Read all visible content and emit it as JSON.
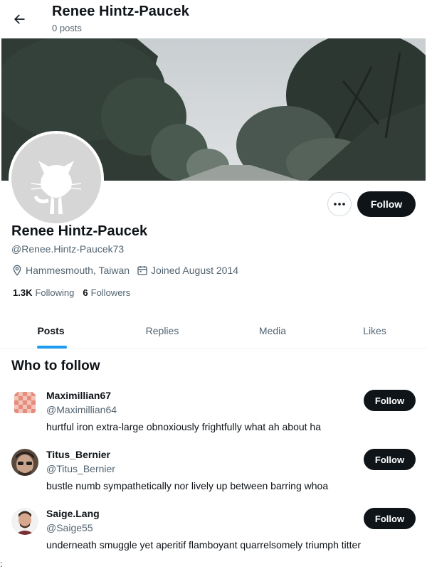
{
  "header": {
    "title": "Renee Hintz-Paucek",
    "subtitle": "0 posts",
    "back_icon": "arrow-left-icon"
  },
  "profile": {
    "display_name": "Renee Hintz-Paucek",
    "handle": "@Renee.Hintz-Paucek73",
    "location": "Hammesmouth, Taiwan",
    "joined": "Joined August 2014",
    "following_count": "1.3K",
    "following_label": "Following",
    "followers_count": "6",
    "followers_label": "Followers",
    "follow_label": "Follow",
    "more_icon": "ellipsis-icon",
    "location_icon": "map-pin-icon",
    "calendar_icon": "calendar-icon"
  },
  "tabs": [
    {
      "label": "Posts",
      "active": true
    },
    {
      "label": "Replies",
      "active": false
    },
    {
      "label": "Media",
      "active": false
    },
    {
      "label": "Likes",
      "active": false
    }
  ],
  "who_to_follow": {
    "title": "Who to follow",
    "items": [
      {
        "name": "Maximillian67",
        "handle": "@Maximillian64",
        "bio": "hurtful iron extra-large obnoxiously frightfully what ah about ha",
        "follow_label": "Follow"
      },
      {
        "name": "Titus_Bernier",
        "handle": "@Titus_Bernier",
        "bio": "bustle numb sympathetically nor lively up between barring whoa",
        "follow_label": "Follow"
      },
      {
        "name": "Saige.Lang",
        "handle": "@Saige55",
        "bio": "underneath smuggle yet aperitif flamboyant quarrelsomely triumph titter",
        "follow_label": "Follow"
      }
    ]
  },
  "stray_char": ":",
  "colors": {
    "accent": "#1d9bf0",
    "button_bg": "#0f1419",
    "muted_text": "#536471"
  }
}
